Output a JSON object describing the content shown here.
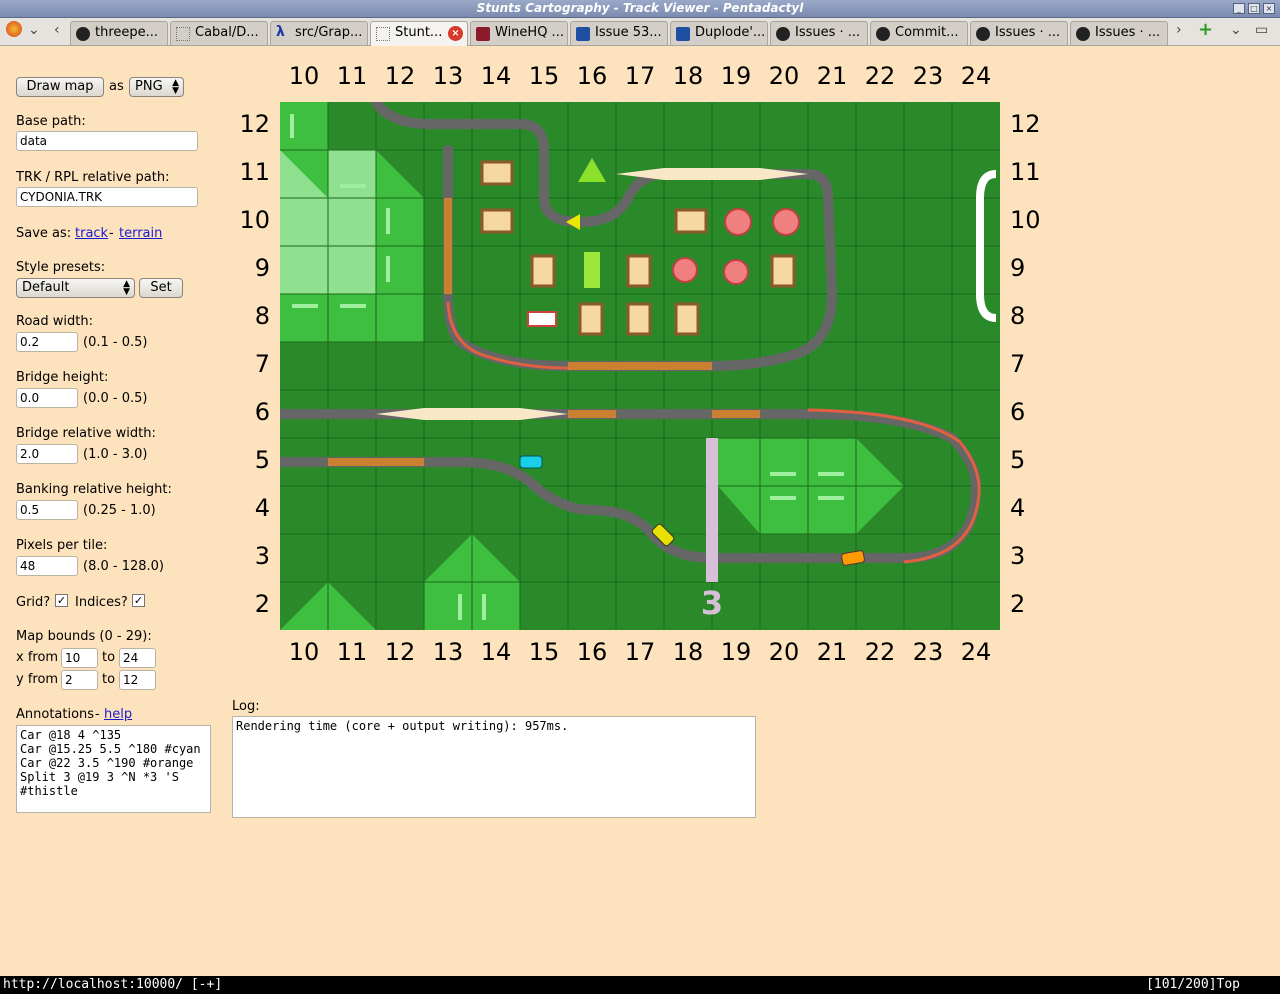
{
  "window": {
    "title": "Stunts Cartography - Track Viewer - Pentadactyl"
  },
  "tabs": [
    {
      "label": "threepe...",
      "icon": "github-icon"
    },
    {
      "label": "Cabal/D...",
      "icon": "blank-page-icon"
    },
    {
      "label": "src/Grap...",
      "icon": "lambda-icon"
    },
    {
      "label": "Stunt...",
      "icon": "blank-page-icon",
      "active": true
    },
    {
      "label": "WineHQ ...",
      "icon": "wine-icon"
    },
    {
      "label": "Issue 53...",
      "icon": "issue-tracker-icon"
    },
    {
      "label": "Duplode'...",
      "icon": "bug-icon"
    },
    {
      "label": "Issues · ...",
      "icon": "github-icon"
    },
    {
      "label": "Commit...",
      "icon": "github-icon"
    },
    {
      "label": "Issues · ...",
      "icon": "github-icon"
    },
    {
      "label": "Issues · ...",
      "icon": "github-icon"
    }
  ],
  "controls": {
    "draw_button": "Draw map",
    "as_label": "as",
    "format": "PNG",
    "base_path_label": "Base path:",
    "base_path": "data",
    "trk_label": "TRK / RPL relative path:",
    "trk_path": "CYDONIA.TRK",
    "save_as_label": "Save as:",
    "save_track": "track",
    "save_sep": "-",
    "save_terrain": "terrain",
    "presets_label": "Style presets:",
    "preset": "Default",
    "set_button": "Set",
    "road_width_label": "Road width:",
    "road_width": "0.2",
    "road_width_range": "(0.1 - 0.5)",
    "bridge_height_label": "Bridge height:",
    "bridge_height": "0.0",
    "bridge_height_range": "(0.0 - 0.5)",
    "bridge_width_label": "Bridge relative width:",
    "bridge_width": "2.0",
    "bridge_width_range": "(1.0 - 3.0)",
    "banking_label": "Banking relative height:",
    "banking": "0.5",
    "banking_range": "(0.25 - 1.0)",
    "ppt_label": "Pixels per tile:",
    "ppt": "48",
    "ppt_range": "(8.0 - 128.0)",
    "grid_label": "Grid?",
    "indices_label": "Indices?",
    "bounds_label": "Map bounds (0 - 29):",
    "x_from_label": "x from",
    "x_from": "10",
    "x_to_label": "to",
    "x_to": "24",
    "y_from_label": "y from",
    "y_from": "2",
    "y_to_label": "to",
    "y_to": "12",
    "annotations_label": "Annotations",
    "annotations_sep": "-",
    "annotations_help": "help",
    "annotations": "Car @18 4 ^135\nCar @15.25 5.5 ^180 #cyan\nCar @22 3.5 ^190 #orange\nSplit 3 @19 3 ^N *3 'S\n#thistle"
  },
  "log": {
    "label": "Log:",
    "text": "Rendering time (core + output writing): 957ms."
  },
  "map": {
    "x_indices": [
      "10",
      "11",
      "12",
      "13",
      "14",
      "15",
      "16",
      "17",
      "18",
      "19",
      "20",
      "21",
      "22",
      "23",
      "24"
    ],
    "y_indices": [
      "12",
      "11",
      "10",
      "9",
      "8",
      "7",
      "6",
      "5",
      "4",
      "3",
      "2"
    ],
    "split_label": "3",
    "colors": {
      "grass": "#2a8a2a",
      "hill": "#3fbf3f",
      "road": "#666666",
      "bridge": "#f8e8c8",
      "cyan_car": "#1ad0e8",
      "orange_car": "#ff9a00",
      "yellow_car": "#e8e000",
      "split": "#d8bfd8"
    }
  },
  "statusbar": {
    "url": "http://localhost:10000/ [-+]",
    "position": "[101/200]Top"
  }
}
